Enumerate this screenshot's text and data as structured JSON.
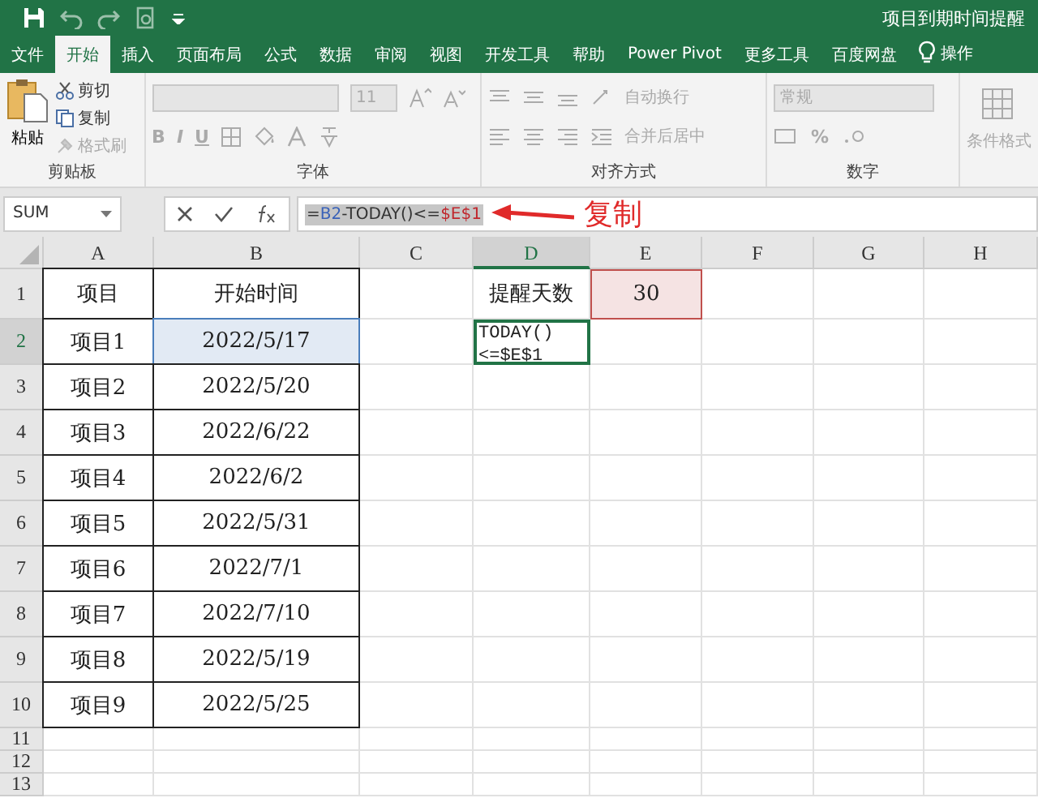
{
  "title_bar": {
    "title": "项目到期时间提醒"
  },
  "tabs": [
    {
      "label": "文件",
      "selected": false
    },
    {
      "label": "开始",
      "selected": true
    },
    {
      "label": "插入",
      "selected": false
    },
    {
      "label": "页面布局",
      "selected": false
    },
    {
      "label": "公式",
      "selected": false
    },
    {
      "label": "数据",
      "selected": false
    },
    {
      "label": "审阅",
      "selected": false
    },
    {
      "label": "视图",
      "selected": false
    },
    {
      "label": "开发工具",
      "selected": false
    },
    {
      "label": "帮助",
      "selected": false
    },
    {
      "label": "Power Pivot",
      "selected": false
    },
    {
      "label": "更多工具",
      "selected": false
    },
    {
      "label": "百度网盘",
      "selected": false
    }
  ],
  "tell_me": {
    "label": "操作"
  },
  "ribbon": {
    "clipboard": {
      "title": "剪贴板",
      "paste": "粘贴",
      "items": [
        {
          "label": "剪切",
          "disabled": false
        },
        {
          "label": "复制",
          "disabled": false
        },
        {
          "label": "格式刷",
          "disabled": true
        }
      ]
    },
    "font": {
      "title": "字体",
      "size": "11",
      "styles": [
        "B",
        "I",
        "U"
      ]
    },
    "alignment": {
      "title": "对齐方式",
      "wrap": "自动换行",
      "merge": "合并后居中"
    },
    "number": {
      "title": "数字",
      "format": "常规",
      "percent": "%"
    },
    "styles": {
      "conditional": "条件格式"
    }
  },
  "formula_bar": {
    "name_box": "SUM",
    "text_selected": true,
    "parts": [
      {
        "text": "=",
        "color": "#333333"
      },
      {
        "text": "B2",
        "color": "#3a62b8"
      },
      {
        "text": "-TODAY()<=",
        "color": "#333333"
      },
      {
        "text": "$E$1",
        "color": "#c0272d"
      }
    ]
  },
  "annotation": {
    "label": "复制"
  },
  "sheet": {
    "columns": [
      {
        "label": "A",
        "selected": false
      },
      {
        "label": "B",
        "selected": false
      },
      {
        "label": "C",
        "selected": false
      },
      {
        "label": "D",
        "selected": true
      },
      {
        "label": "E",
        "selected": false
      },
      {
        "label": "F",
        "selected": false
      },
      {
        "label": "G",
        "selected": false
      },
      {
        "label": "H",
        "selected": false
      }
    ],
    "rows": [
      {
        "number": "1",
        "selected": false,
        "cells": [
          {
            "kind": "text",
            "text": "项目",
            "boxed": true
          },
          {
            "kind": "text",
            "text": "开始时间",
            "boxed": true
          },
          {
            "kind": "empty"
          },
          {
            "kind": "text",
            "text": "提醒天数",
            "boxed": false
          },
          {
            "kind": "text",
            "text": "30",
            "boxed": false,
            "color": "#c0504d"
          }
        ]
      },
      {
        "number": "2",
        "selected": true,
        "cells": [
          {
            "kind": "text",
            "text": "项目1",
            "boxed": true
          },
          {
            "kind": "text",
            "text": "2022/5/17",
            "boxed": true,
            "color": "#4a7ebb"
          },
          {
            "kind": "empty"
          },
          {
            "kind": "edit",
            "lines": [
              "TODAY()",
              "<=$E$1"
            ]
          }
        ]
      },
      {
        "number": "3",
        "selected": false,
        "cells": [
          {
            "kind": "text",
            "text": "项目2",
            "boxed": true
          },
          {
            "kind": "text",
            "text": "2022/5/20",
            "boxed": true
          }
        ]
      },
      {
        "number": "4",
        "selected": false,
        "cells": [
          {
            "kind": "text",
            "text": "项目3",
            "boxed": true
          },
          {
            "kind": "text",
            "text": "2022/6/22",
            "boxed": true
          }
        ]
      },
      {
        "number": "5",
        "selected": false,
        "cells": [
          {
            "kind": "text",
            "text": "项目4",
            "boxed": true
          },
          {
            "kind": "text",
            "text": "2022/6/2",
            "boxed": true
          }
        ]
      },
      {
        "number": "6",
        "selected": false,
        "cells": [
          {
            "kind": "text",
            "text": "项目5",
            "boxed": true
          },
          {
            "kind": "text",
            "text": "2022/5/31",
            "boxed": true
          }
        ]
      },
      {
        "number": "7",
        "selected": false,
        "cells": [
          {
            "kind": "text",
            "text": "项目6",
            "boxed": true
          },
          {
            "kind": "text",
            "text": "2022/7/1",
            "boxed": true
          }
        ]
      },
      {
        "number": "8",
        "selected": false,
        "cells": [
          {
            "kind": "text",
            "text": "项目7",
            "boxed": true
          },
          {
            "kind": "text",
            "text": "2022/7/10",
            "boxed": true
          }
        ]
      },
      {
        "number": "9",
        "selected": false,
        "cells": [
          {
            "kind": "text",
            "text": "项目8",
            "boxed": true
          },
          {
            "kind": "text",
            "text": "2022/5/19",
            "boxed": true
          }
        ]
      },
      {
        "number": "10",
        "selected": false,
        "cells": [
          {
            "kind": "text",
            "text": "项目9",
            "boxed": true
          },
          {
            "kind": "text",
            "text": "2022/5/25",
            "boxed": true
          }
        ]
      },
      {
        "number": "11",
        "selected": false,
        "cells": []
      },
      {
        "number": "12",
        "selected": false,
        "cells": []
      },
      {
        "number": "13",
        "selected": false,
        "cells": []
      }
    ]
  }
}
